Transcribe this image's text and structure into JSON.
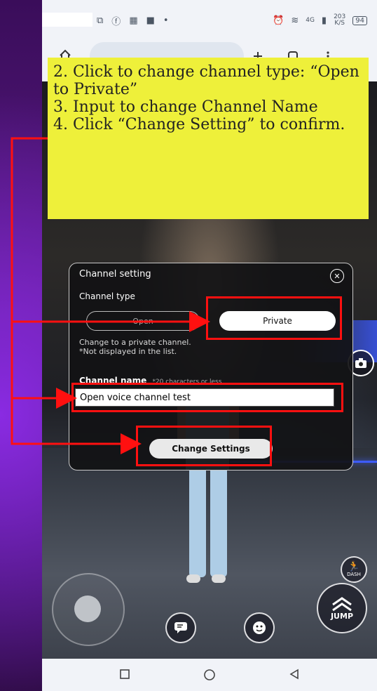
{
  "status_bar": {
    "network_label": "4G",
    "speed_value": "203",
    "speed_unit": "K/S",
    "battery": "94"
  },
  "callout": {
    "lines": [
      "2. Click to change channel type: “Open to Private”",
      "3. Input to change Channel Name",
      "4. Click “Change Setting” to confirm."
    ]
  },
  "dialog": {
    "title": "Channel setting",
    "channel_type_label": "Channel type",
    "option_open": "Open",
    "option_private": "Private",
    "hint_line1": "Change to a private channel.",
    "hint_line2": "*Not displayed in the list.",
    "channel_name_label": "Channel name",
    "channel_name_note": "*20 characters or less",
    "channel_name_value": "Open voice channel test",
    "submit_label": "Change Settings"
  },
  "game_controls": {
    "jump_label": "JUMP",
    "dash_label": "DASH"
  },
  "colors": {
    "highlight": "#ff1010",
    "callout_bg": "#eef03a",
    "backdrop": "#5a1a86"
  }
}
